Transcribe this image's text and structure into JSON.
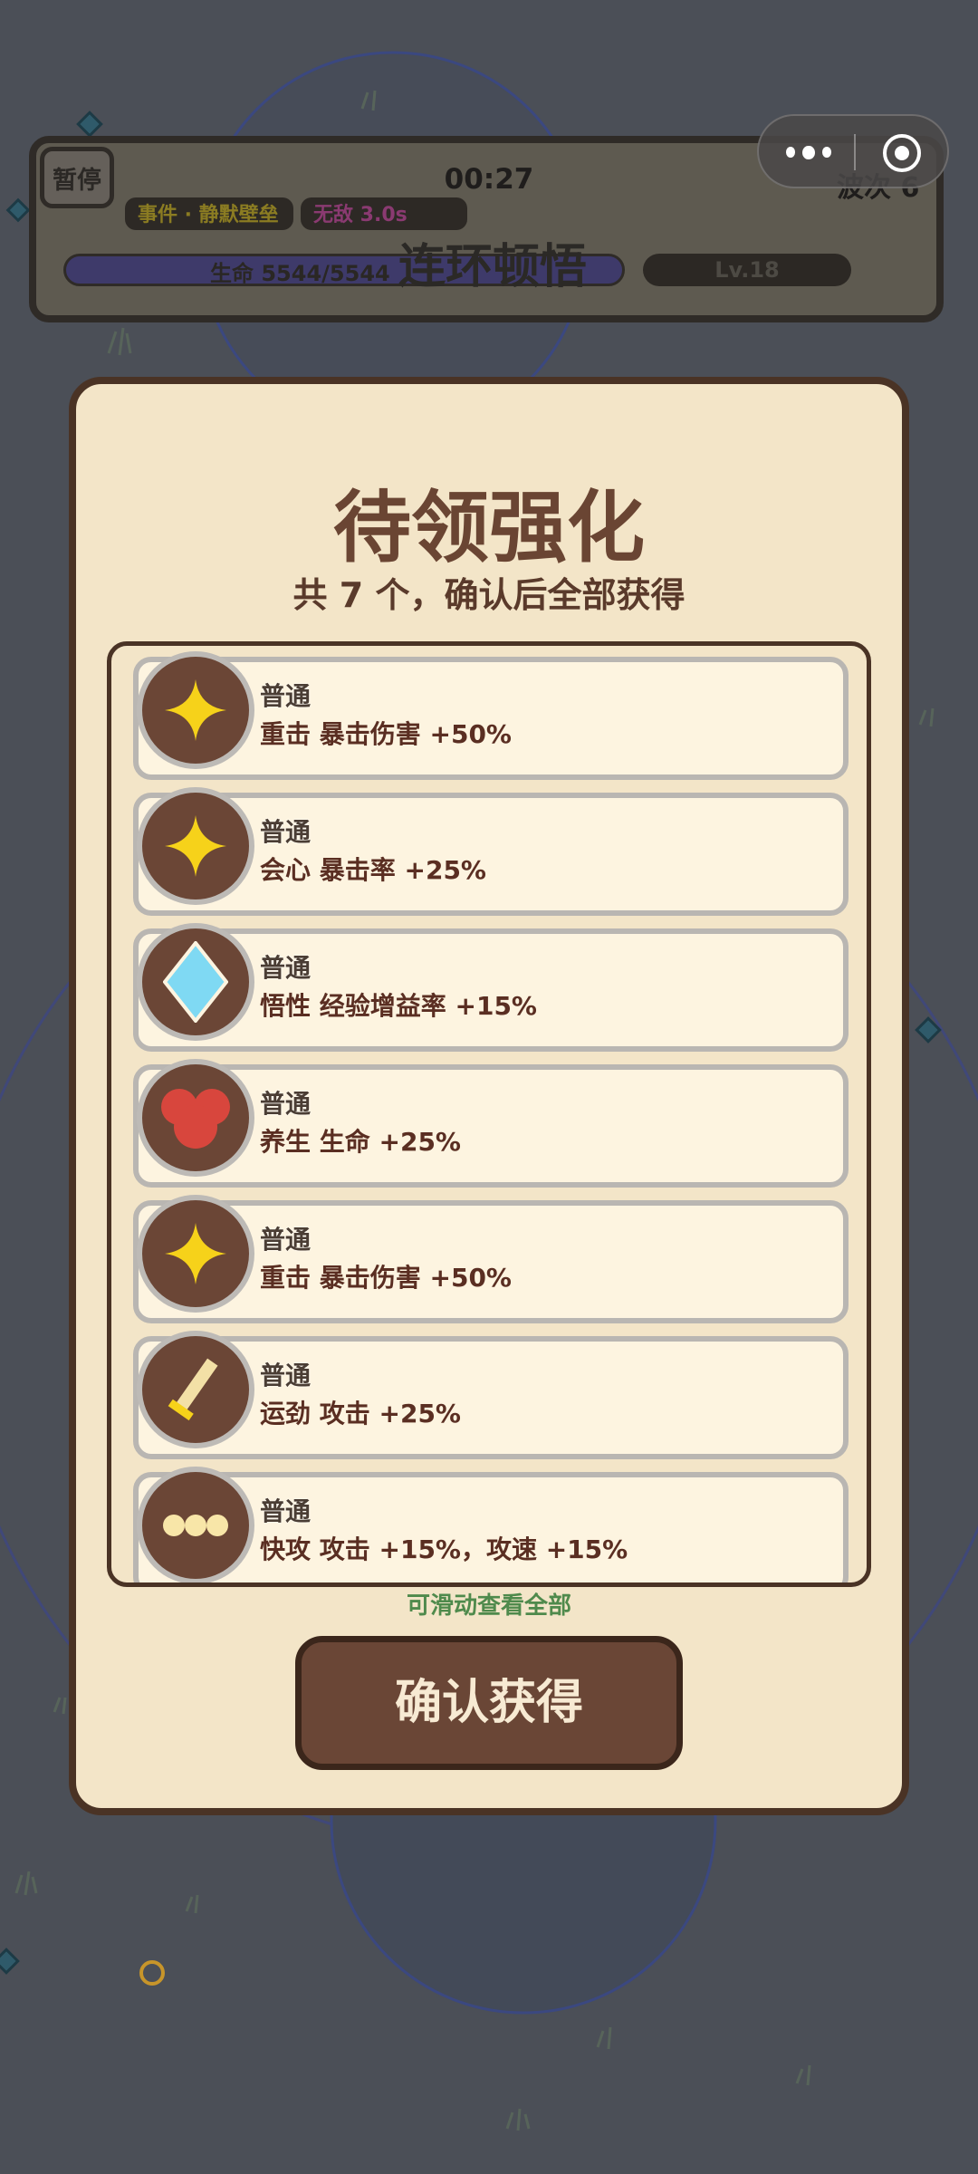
{
  "hud": {
    "pause_label": "暂停",
    "timer": "00:27",
    "wave": "波次 6",
    "event_tag": "事件 · 静默壁垒",
    "invincible_tag": "无敌 3.0s",
    "hp_text": "生命 5544/5544",
    "level": "Lv.18",
    "combo_title": "连环顿悟"
  },
  "modal": {
    "title": "待领强化",
    "subtitle": "共 7 个，确认后全部获得",
    "scroll_hint": "可滑动查看全部",
    "confirm_label": "确认获得"
  },
  "upgrades": [
    {
      "rarity": "普通",
      "text": "重击  暴击伤害 +50%",
      "icon": "star-icon"
    },
    {
      "rarity": "普通",
      "text": "会心  暴击率 +25%",
      "icon": "star-icon"
    },
    {
      "rarity": "普通",
      "text": "悟性  经验增益率 +15%",
      "icon": "diamond-icon"
    },
    {
      "rarity": "普通",
      "text": "养生  生命 +25%",
      "icon": "heart-icon"
    },
    {
      "rarity": "普通",
      "text": "重击  暴击伤害 +50%",
      "icon": "star-icon"
    },
    {
      "rarity": "普通",
      "text": "运劲  攻击 +25%",
      "icon": "sword-icon"
    },
    {
      "rarity": "普通",
      "text": "快攻  攻击 +15%，攻速 +15%",
      "icon": "triple-dot-icon"
    }
  ],
  "colors": {
    "modal_bg": "#f3e5c8",
    "modal_border": "#4a3325",
    "title": "#6a4533",
    "hint": "#4f8a4c",
    "confirm_bg": "#6a4636"
  }
}
